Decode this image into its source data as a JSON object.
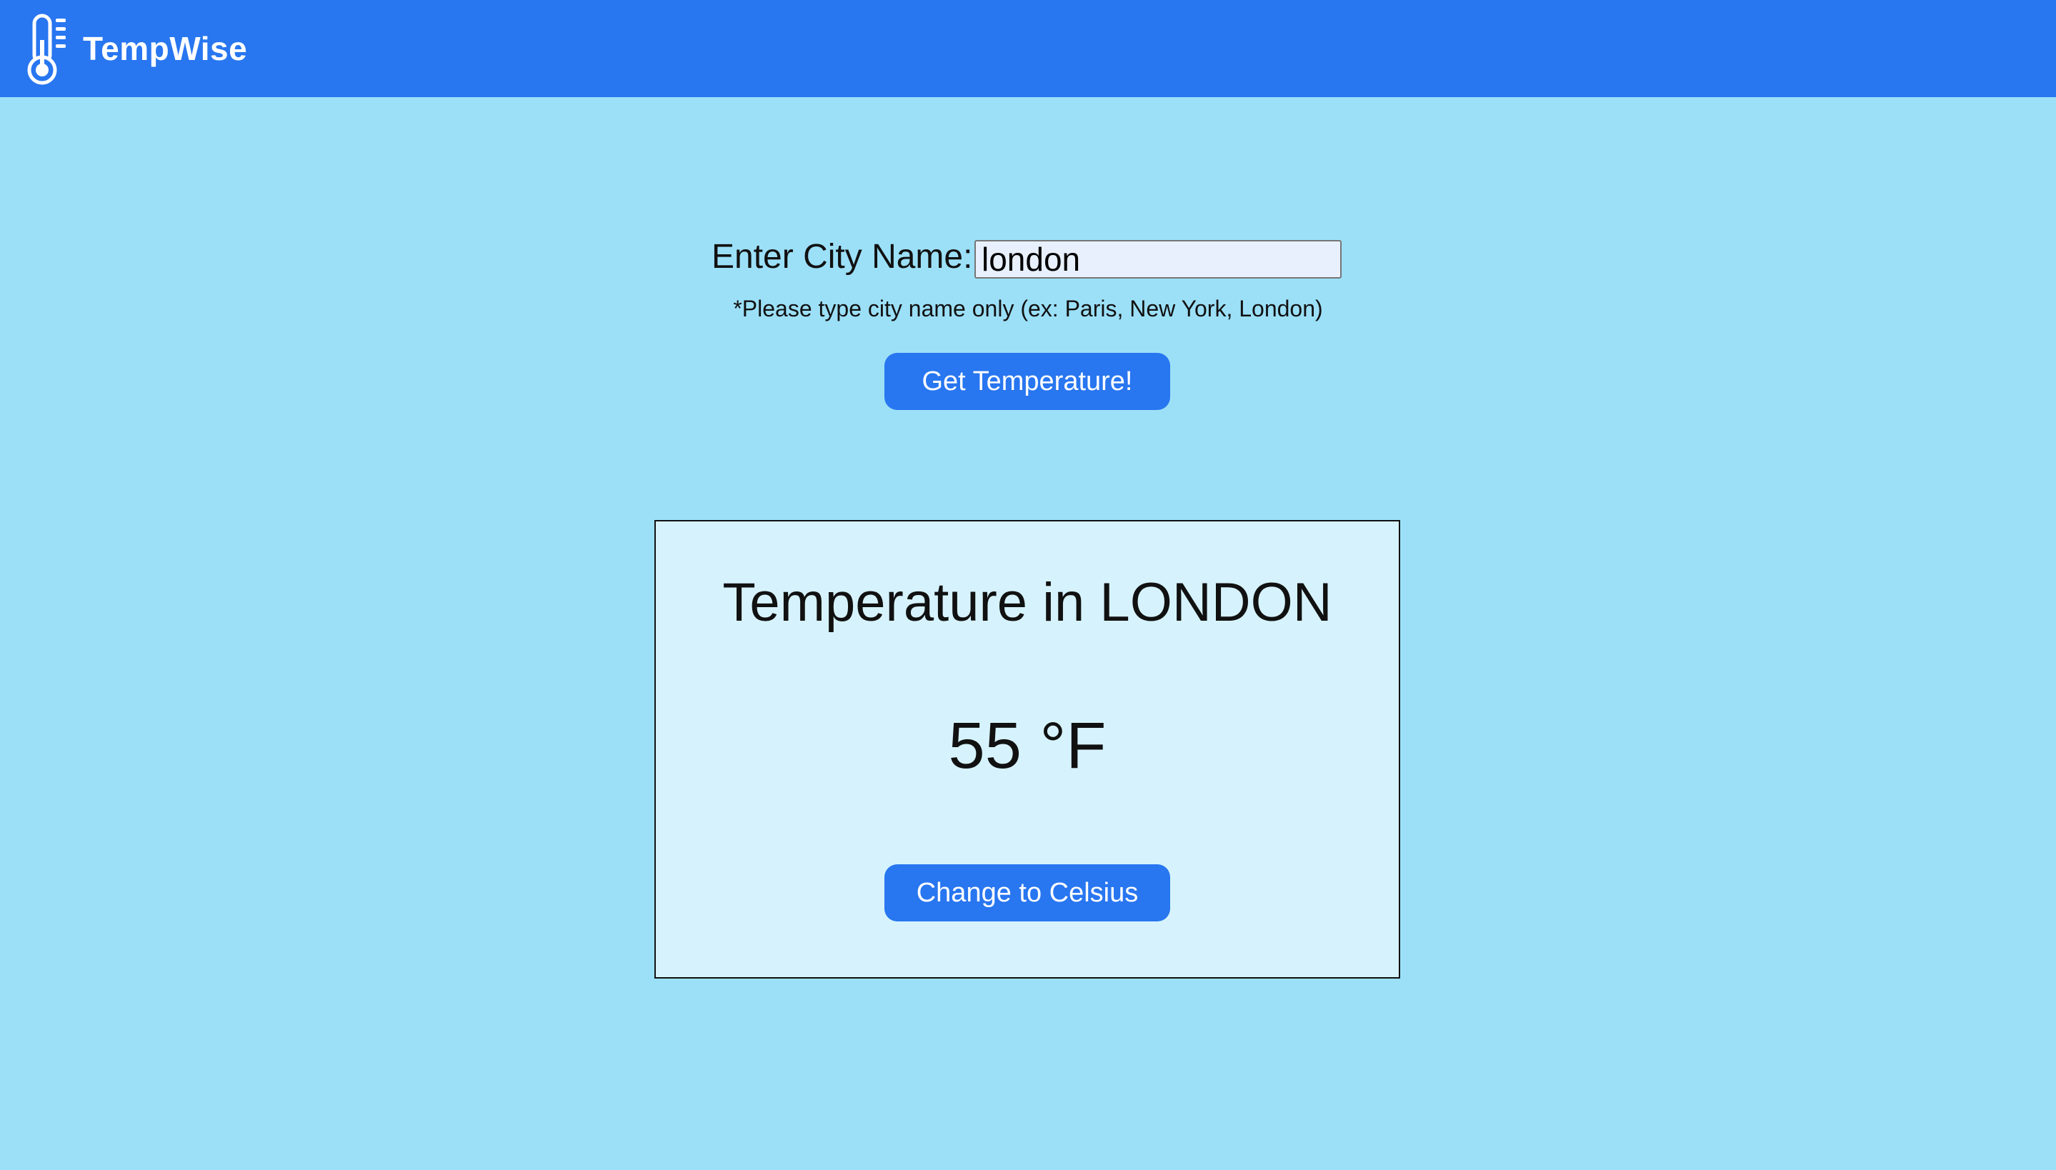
{
  "navbar": {
    "brand_name": "TempWise",
    "brand_icon": "thermometer-icon",
    "color": "#2876f0"
  },
  "search": {
    "label": "Enter City Name:",
    "value": "london",
    "hint": "*Please type city name only (ex: Paris, New York, London)",
    "submit_label": "Get Temperature!"
  },
  "result": {
    "title": "Temperature in LONDON",
    "temperature": "55 °F",
    "toggle_label": "Change to Celsius"
  },
  "colors": {
    "page_background": "#9ce0f8",
    "card_background": "#d6f3fd",
    "button": "#2876f0"
  }
}
